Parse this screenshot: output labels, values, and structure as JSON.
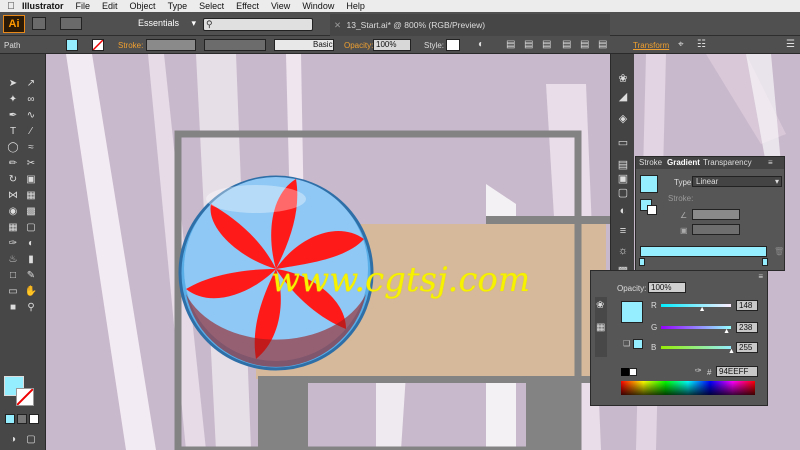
{
  "menubar": {
    "app": "Illustrator",
    "menus": [
      "File",
      "Edit",
      "Object",
      "Type",
      "Select",
      "Effect",
      "View",
      "Window",
      "Help"
    ]
  },
  "appbar": {
    "logo": "Ai",
    "workspace": "Essentials",
    "document_title": "13_Start.ai* @ 800% (RGB/Preview)"
  },
  "control": {
    "object_type": "Path",
    "stroke_label": "Stroke:",
    "brush": "Basic",
    "opacity_label": "Opacity:",
    "opacity_value": "100%",
    "style_label": "Style:",
    "transform_label": "Transform"
  },
  "gradient_panel": {
    "tabs": [
      "Stroke",
      "Gradient",
      "Transparency"
    ],
    "type_label": "Type:",
    "type_value": "Linear",
    "stroke_label": "Stroke:"
  },
  "color_panel": {
    "opacity_label": "Opacity:",
    "opacity_value": "100%",
    "channels": [
      {
        "label": "R",
        "value": "148",
        "fraction": 0.58,
        "gradient": "linear-gradient(90deg,#00eeff,#ffeeff)"
      },
      {
        "label": "G",
        "value": "238",
        "fraction": 0.93,
        "gradient": "linear-gradient(90deg,#9400ff,#94ffff)"
      },
      {
        "label": "B",
        "value": "255",
        "fraction": 1.0,
        "gradient": "linear-gradient(90deg,#94ee00,#94eeff)"
      }
    ],
    "hex_label": "#",
    "hex_value": "94EEFF",
    "current_color": "#94EEFF"
  },
  "watermark": "www.cgtsj.com",
  "colors": {
    "accent": "#94EEFF",
    "candy_red": "#ff1a1a",
    "candy_blue": "#8fc8f5",
    "canvas_bg": "#c9b9cc",
    "tan": "#d6b89a"
  }
}
